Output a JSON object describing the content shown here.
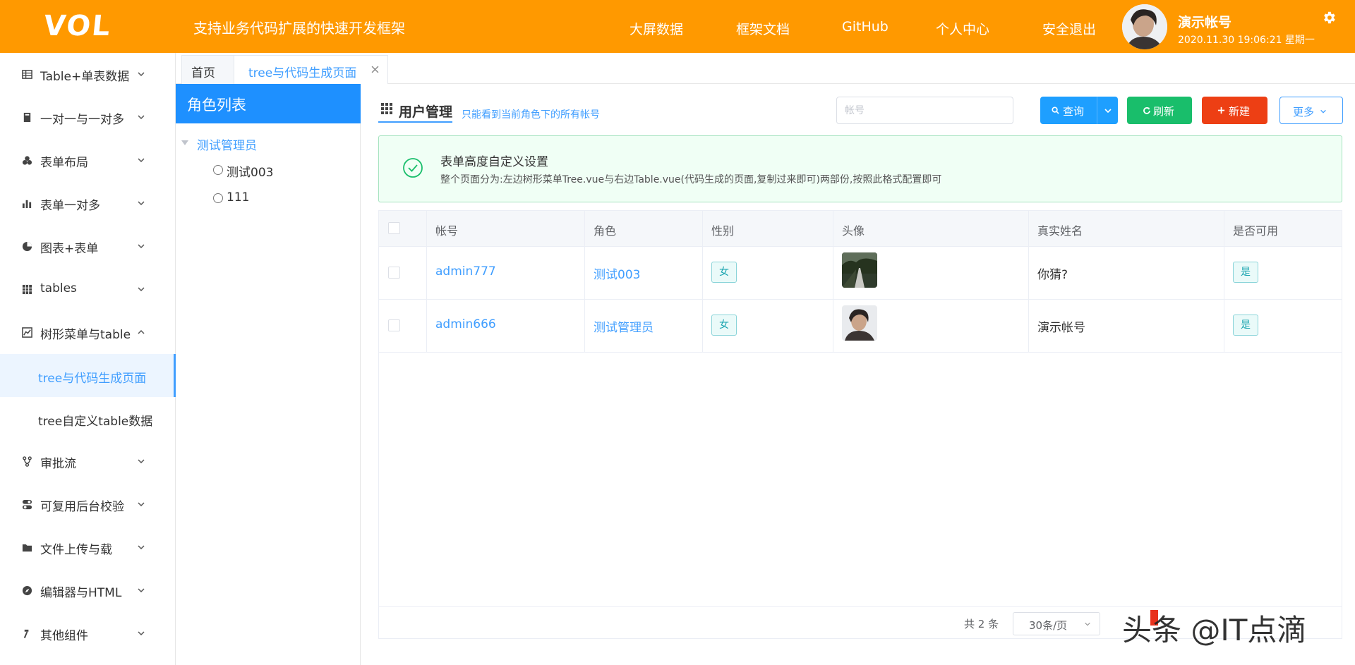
{
  "header": {
    "logo": "VOL",
    "slogan": "支持业务代码扩展的快速开发框架",
    "nav": [
      "大屏数据",
      "框架文档",
      "GitHub",
      "个人中心",
      "安全退出"
    ],
    "user_name": "演示帐号",
    "datetime": "2020.11.30 19:06:21 星期一"
  },
  "sidebar": {
    "items": [
      {
        "label": "Table+单表数据",
        "icon": "table-icon"
      },
      {
        "label": "一对一与一对多",
        "icon": "book-icon"
      },
      {
        "label": "表单布局",
        "icon": "cubes-icon"
      },
      {
        "label": "表单一对多",
        "icon": "bar-chart-icon"
      },
      {
        "label": "图表+表单",
        "icon": "pie-chart-icon"
      },
      {
        "label": "tables",
        "icon": "grid-icon"
      },
      {
        "label": "树形菜单与table",
        "icon": "area-chart-icon"
      }
    ],
    "sub_items": [
      "tree与代码生成页面",
      "tree自定义table数据"
    ],
    "items_after": [
      {
        "label": "审批流",
        "icon": "flow-icon"
      },
      {
        "label": "可复用后台校验",
        "icon": "toggle-icon"
      },
      {
        "label": "文件上传与载",
        "icon": "folder-icon"
      },
      {
        "label": "编辑器与HTML",
        "icon": "compass-icon"
      },
      {
        "label": "其他组件",
        "icon": "hammer-icon"
      }
    ]
  },
  "tabs": [
    "首页",
    "tree与代码生成页面"
  ],
  "tree": {
    "title": "角色列表",
    "root": "测试管理员",
    "children": [
      "测试003",
      "111"
    ]
  },
  "panel": {
    "title": "用户管理",
    "subtitle": "只能看到当前角色下的所有帐号",
    "search_placeholder": "帐号",
    "btn_query": "查询",
    "btn_refresh": "刷新",
    "btn_new": "新建",
    "btn_more": "更多"
  },
  "alert": {
    "title": "表单高度自定义设置",
    "desc": "整个页面分为:左边树形菜单Tree.vue与右边Table.vue(代码生成的页面,复制过来即可)两部份,按照此格式配置即可"
  },
  "table": {
    "columns": [
      "帐号",
      "角色",
      "性别",
      "头像",
      "真实姓名",
      "是否可用"
    ],
    "rows": [
      {
        "account": "admin777",
        "role": "测试003",
        "gender": "女",
        "avatar": "road-photo",
        "realname": "你猜?",
        "enabled": "是"
      },
      {
        "account": "admin666",
        "role": "测试管理员",
        "gender": "女",
        "avatar": "man-photo",
        "realname": "演示帐号",
        "enabled": "是"
      }
    ],
    "total": "共 2 条",
    "page_size": "30条/页"
  },
  "watermark": "头条 @IT点滴",
  "colors": {
    "header": "#ff9900",
    "primary": "#409eff",
    "tree_header": "#1e90ff",
    "refresh": "#19be6b",
    "new": "#ed3f14"
  }
}
